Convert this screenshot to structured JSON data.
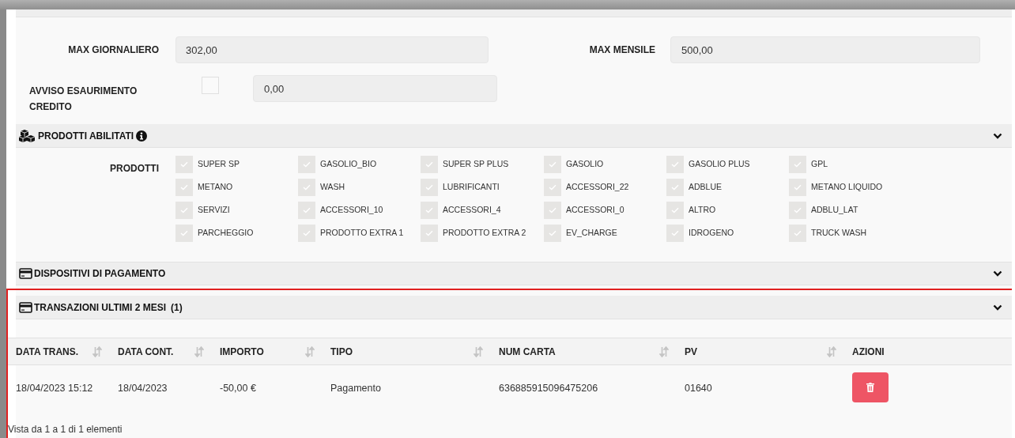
{
  "limits": {
    "max_daily": {
      "label": "MAX GIORNALIERO",
      "value": "302,00"
    },
    "max_monthly": {
      "label": "MAX MENSILE",
      "value": "500,00"
    },
    "credit_warning": {
      "label": "AVVISO ESAURIMENTO CREDITO",
      "checked": false,
      "value": "0,00"
    }
  },
  "products_section": {
    "title": "PRODOTTI ABILITATI",
    "label": "PRODOTTI",
    "items": [
      {
        "label": "SUPER SP",
        "checked": true
      },
      {
        "label": "GASOLIO_BIO",
        "checked": true
      },
      {
        "label": "SUPER SP PLUS",
        "checked": true
      },
      {
        "label": "GASOLIO",
        "checked": true
      },
      {
        "label": "GASOLIO PLUS",
        "checked": true
      },
      {
        "label": "GPL",
        "checked": true
      },
      {
        "label": "METANO",
        "checked": true
      },
      {
        "label": "WASH",
        "checked": true
      },
      {
        "label": "LUBRIFICANTI",
        "checked": true
      },
      {
        "label": "ACCESSORI_22",
        "checked": true
      },
      {
        "label": "ADBLUE",
        "checked": true
      },
      {
        "label": "METANO LIQUIDO",
        "checked": true
      },
      {
        "label": "SERVIZI",
        "checked": true
      },
      {
        "label": "ACCESSORI_10",
        "checked": true
      },
      {
        "label": "ACCESSORI_4",
        "checked": true
      },
      {
        "label": "ACCESSORI_0",
        "checked": true
      },
      {
        "label": "ALTRO",
        "checked": true
      },
      {
        "label": "ADBLU_LAT",
        "checked": true
      },
      {
        "label": "PARCHEGGIO",
        "checked": true
      },
      {
        "label": "PRODOTTO EXTRA 1",
        "checked": true
      },
      {
        "label": "PRODOTTO EXTRA 2",
        "checked": true
      },
      {
        "label": "EV_CHARGE",
        "checked": true
      },
      {
        "label": "IDROGENO",
        "checked": true
      },
      {
        "label": "TRUCK WASH",
        "checked": true
      }
    ]
  },
  "payment_devices_section": {
    "title": "DISPOSITIVI DI PAGAMENTO"
  },
  "transactions_section": {
    "title": "TRANSAZIONI ULTIMI 2 MESI",
    "count": "(1)",
    "columns": [
      {
        "label": "DATA TRANS.",
        "sortable": true
      },
      {
        "label": "DATA CONT.",
        "sortable": true
      },
      {
        "label": "IMPORTO",
        "sortable": true
      },
      {
        "label": "TIPO",
        "sortable": true
      },
      {
        "label": "NUM CARTA",
        "sortable": true
      },
      {
        "label": "PV",
        "sortable": true
      },
      {
        "label": "AZIONI",
        "sortable": false
      }
    ],
    "rows": [
      {
        "cells": [
          "18/04/2023 15:12",
          "18/04/2023",
          "-50,00 €",
          "Pagamento",
          "636885915096475206",
          "01640"
        ]
      }
    ],
    "footer": "Vista da 1 a 1 di 1 elementi"
  }
}
